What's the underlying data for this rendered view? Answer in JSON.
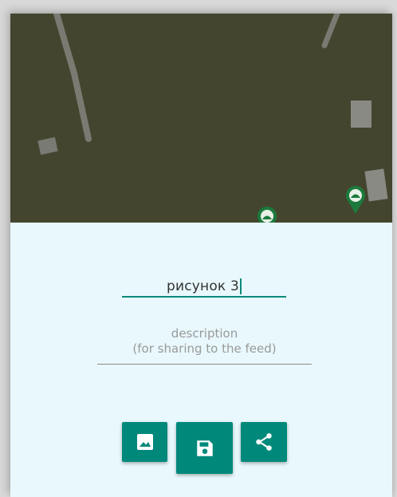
{
  "form": {
    "name_value": "рисунок 3",
    "description_placeholder": "description\n(for sharing to the feed)"
  },
  "actions": [
    {
      "icon": "image-icon"
    },
    {
      "icon": "save-icon"
    },
    {
      "icon": "share-icon"
    }
  ],
  "map": {
    "markers": [
      {
        "icon": "map-pin-icon"
      },
      {
        "icon": "map-pin-icon"
      }
    ]
  },
  "colors": {
    "map_background": "#44452f",
    "panel_background": "#e8f8fc",
    "accent": "#00897b"
  }
}
